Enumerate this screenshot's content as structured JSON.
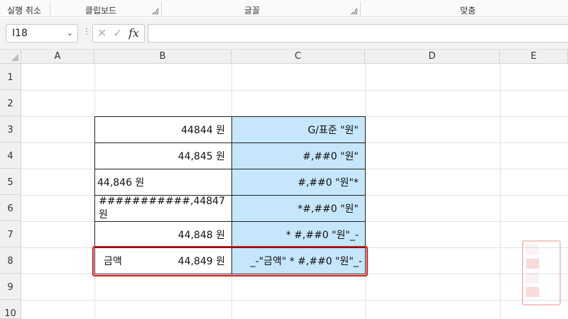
{
  "ribbon": {
    "groups": [
      "실행 취소",
      "클립보드",
      "글꼴",
      "맞춤"
    ]
  },
  "formula_bar": {
    "name_box": "I18",
    "formula": ""
  },
  "columns": [
    "A",
    "B",
    "C",
    "D",
    "E"
  ],
  "rows": [
    "1",
    "2",
    "3",
    "4",
    "5",
    "6",
    "7",
    "8",
    "9",
    "10"
  ],
  "table": [
    {
      "b": "44844 원",
      "c": "G/표준 \"원\""
    },
    {
      "b": "44,845 원",
      "c": "#,##0 \"원\""
    },
    {
      "b": "44,846 원",
      "c": "#,##0 \"원\"*"
    },
    {
      "b": "###########,44847 원",
      "c": "*#,##0 \"원\""
    },
    {
      "b": "44,848 원",
      "c": "* #,##0 \"원\"_-"
    },
    {
      "b_label": "금액",
      "b": "44,849 원",
      "c": "_-\"금액\" * #,##0 \"원\"_-"
    }
  ],
  "colors": {
    "format_fill": "#c6e6fb",
    "highlight": "#e01414",
    "header_bg": "#f0f0f0"
  }
}
